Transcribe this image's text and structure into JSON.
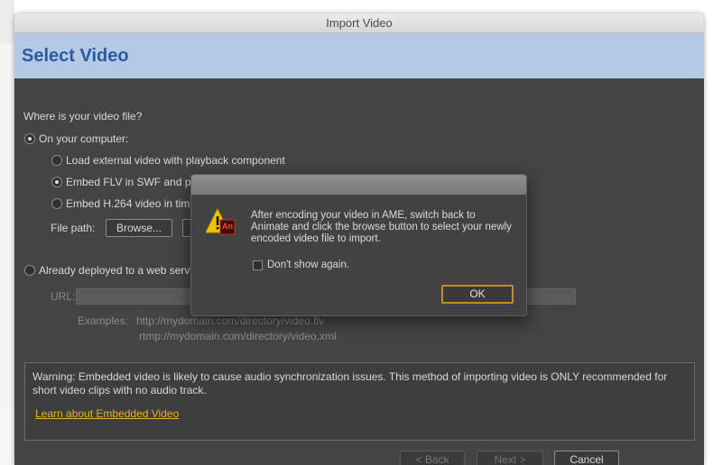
{
  "window": {
    "title": "Import Video"
  },
  "header": {
    "title": "Select Video"
  },
  "form": {
    "question": "Where is your video file?",
    "on_computer": "On your computer:",
    "options": {
      "load_external": "Load external video with playback component",
      "embed_flv": "Embed FLV in SWF and pla",
      "embed_h264": "Embed H.264 video in tim"
    },
    "file_path_label": "File path:",
    "browse_label": "Browse...",
    "web_server": "Already deployed to a web serv",
    "url_label": "URL:",
    "examples_label": "Examples:",
    "example1": "http://mydomain.com/directory/video.flv",
    "example2": "rtmp://mydomain.com/directory/video.xml"
  },
  "warning": {
    "text": "Warning: Embedded video is likely to cause audio synchronization issues. This method of importing video is ONLY recommended for short video clips with no audio track.",
    "link": "Learn about Embedded Video"
  },
  "footer": {
    "back": "< Back",
    "next": "Next >",
    "cancel": "Cancel"
  },
  "alert": {
    "icon_badge": "An",
    "message": "After encoding your video in AME, switch back to Animate and click the browse button to select your newly encoded video file to import.",
    "checkbox_label": "Don't show again.",
    "ok": "OK"
  },
  "colors": {
    "header_bg": "#b4c9e6",
    "header_text": "#2a5aa0",
    "dialog_bg": "#444444",
    "link": "#e8b028",
    "ok_border": "#c98a1e"
  }
}
